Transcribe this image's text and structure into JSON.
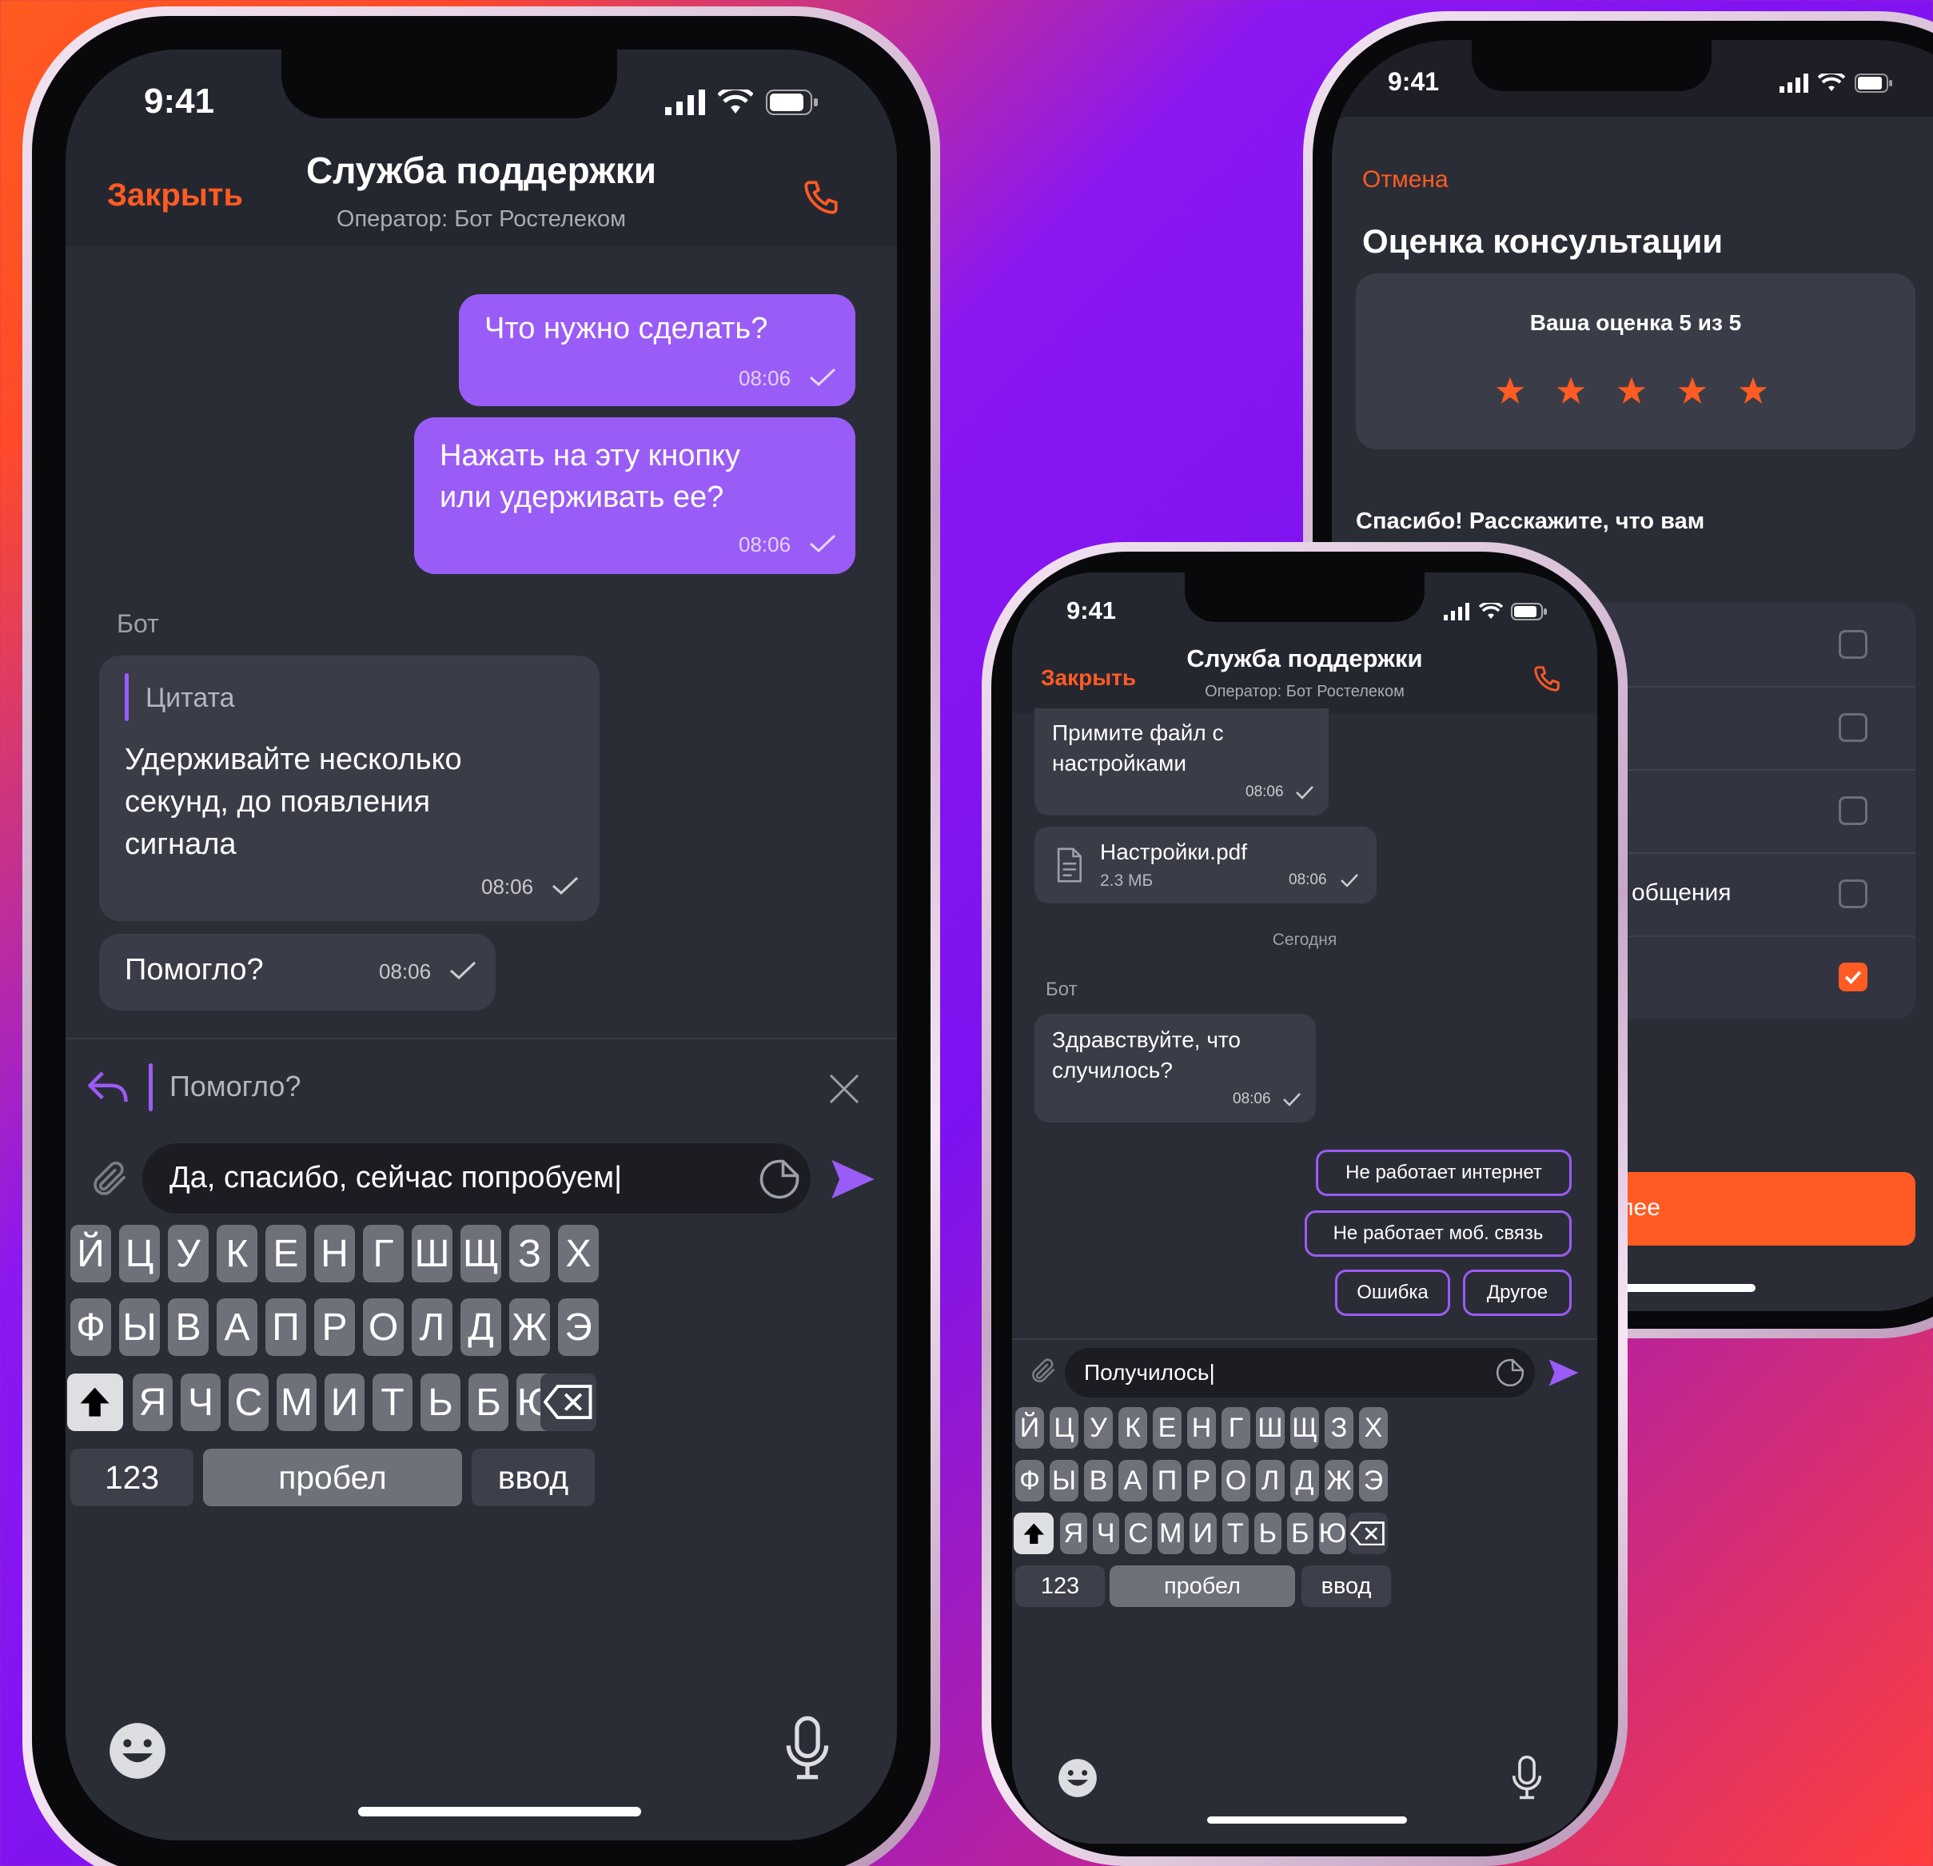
{
  "status": {
    "time": "9:41"
  },
  "chat1": {
    "header": {
      "close": "Закрыть",
      "title": "Служба поддержки",
      "subtitle": "Оператор: Бот Ростелеком"
    },
    "messages": [
      {
        "text": "Что нужно сделать?",
        "time": "08:06"
      },
      {
        "text": "Нажать на эту кнопку или удерживать ее?",
        "time": "08:06"
      }
    ],
    "sender": "Бот",
    "quote": {
      "label": "Цитата",
      "text": "Удерживайте несколько секунд, до появления сигнала",
      "time": "08:06"
    },
    "reply_msg": {
      "text": "Помогло?",
      "time": "08:06"
    },
    "reply_preview": "Помогло?",
    "input_value": "Да, спасибо, сейчас попробуем|"
  },
  "keyboard": {
    "row1": [
      "Й",
      "Ц",
      "У",
      "К",
      "Е",
      "Н",
      "Г",
      "Ш",
      "Щ",
      "З",
      "Х"
    ],
    "row2": [
      "Ф",
      "Ы",
      "В",
      "А",
      "П",
      "Р",
      "О",
      "Л",
      "Д",
      "Ж",
      "Э"
    ],
    "row3": [
      "Я",
      "Ч",
      "С",
      "М",
      "И",
      "Т",
      "Ь",
      "Б",
      "Ю"
    ],
    "numbers": "123",
    "space": "пробел",
    "enter": "ввод"
  },
  "chat2": {
    "header": {
      "close": "Закрыть",
      "title": "Служба поддержки",
      "subtitle": "Оператор: Бот Ростелеком"
    },
    "msg1": {
      "text": "Примите файл с настройками",
      "time": "08:06"
    },
    "file": {
      "name": "Настройки.pdf",
      "size": "2.3 МБ",
      "time": "08:06"
    },
    "date": "Сегодня",
    "sender": "Бот",
    "msg2": {
      "text": "Здравствуйте, что случилось?",
      "time": "08:06"
    },
    "chips": [
      "Не работает интернет",
      "Не работает моб. связь",
      "Ошибка",
      "Другое"
    ],
    "input_value": "Получилось|"
  },
  "rating": {
    "cancel": "Отмена",
    "title": "Оценка консультации",
    "score_text": "Ваша оценка 5 из 5",
    "score": 5,
    "prompt": "Спасибо! Расскажите, что вам",
    "option_fragment": "а общения",
    "checks": [
      false,
      false,
      false,
      false,
      true
    ],
    "button_fragment": "лее"
  },
  "colors": {
    "accent": "#ff5b23",
    "purple": "#9a5cf6",
    "bg": "#2b2d36"
  }
}
